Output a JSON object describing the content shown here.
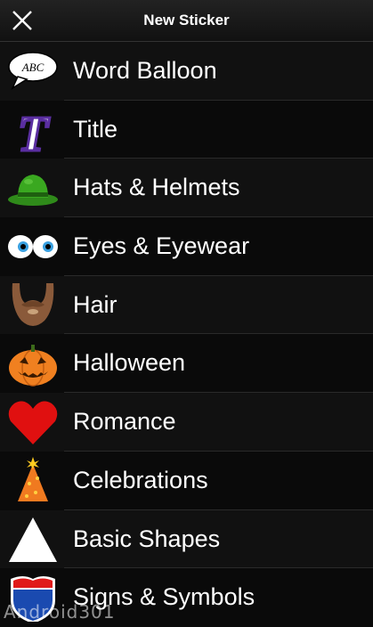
{
  "header": {
    "title": "New Sticker",
    "close_icon": "close-icon"
  },
  "items": [
    {
      "name": "word-balloon",
      "label": "Word Balloon",
      "icon": "speech-bubble-icon",
      "icon_text": "ABC"
    },
    {
      "name": "title",
      "label": "Title",
      "icon": "letter-t-icon",
      "icon_text": "T"
    },
    {
      "name": "hats-helmets",
      "label": "Hats & Helmets",
      "icon": "green-hat-icon"
    },
    {
      "name": "eyes-eyewear",
      "label": "Eyes & Eyewear",
      "icon": "cartoon-eyes-icon"
    },
    {
      "name": "hair",
      "label": "Hair",
      "icon": "beard-icon"
    },
    {
      "name": "halloween",
      "label": "Halloween",
      "icon": "pumpkin-icon"
    },
    {
      "name": "romance",
      "label": "Romance",
      "icon": "heart-icon"
    },
    {
      "name": "celebrations",
      "label": "Celebrations",
      "icon": "party-hat-icon"
    },
    {
      "name": "basic-shapes",
      "label": "Basic Shapes",
      "icon": "triangle-icon"
    },
    {
      "name": "signs-symbols",
      "label": "Signs & Symbols",
      "icon": "highway-shield-icon"
    }
  ],
  "watermark": "Android301"
}
